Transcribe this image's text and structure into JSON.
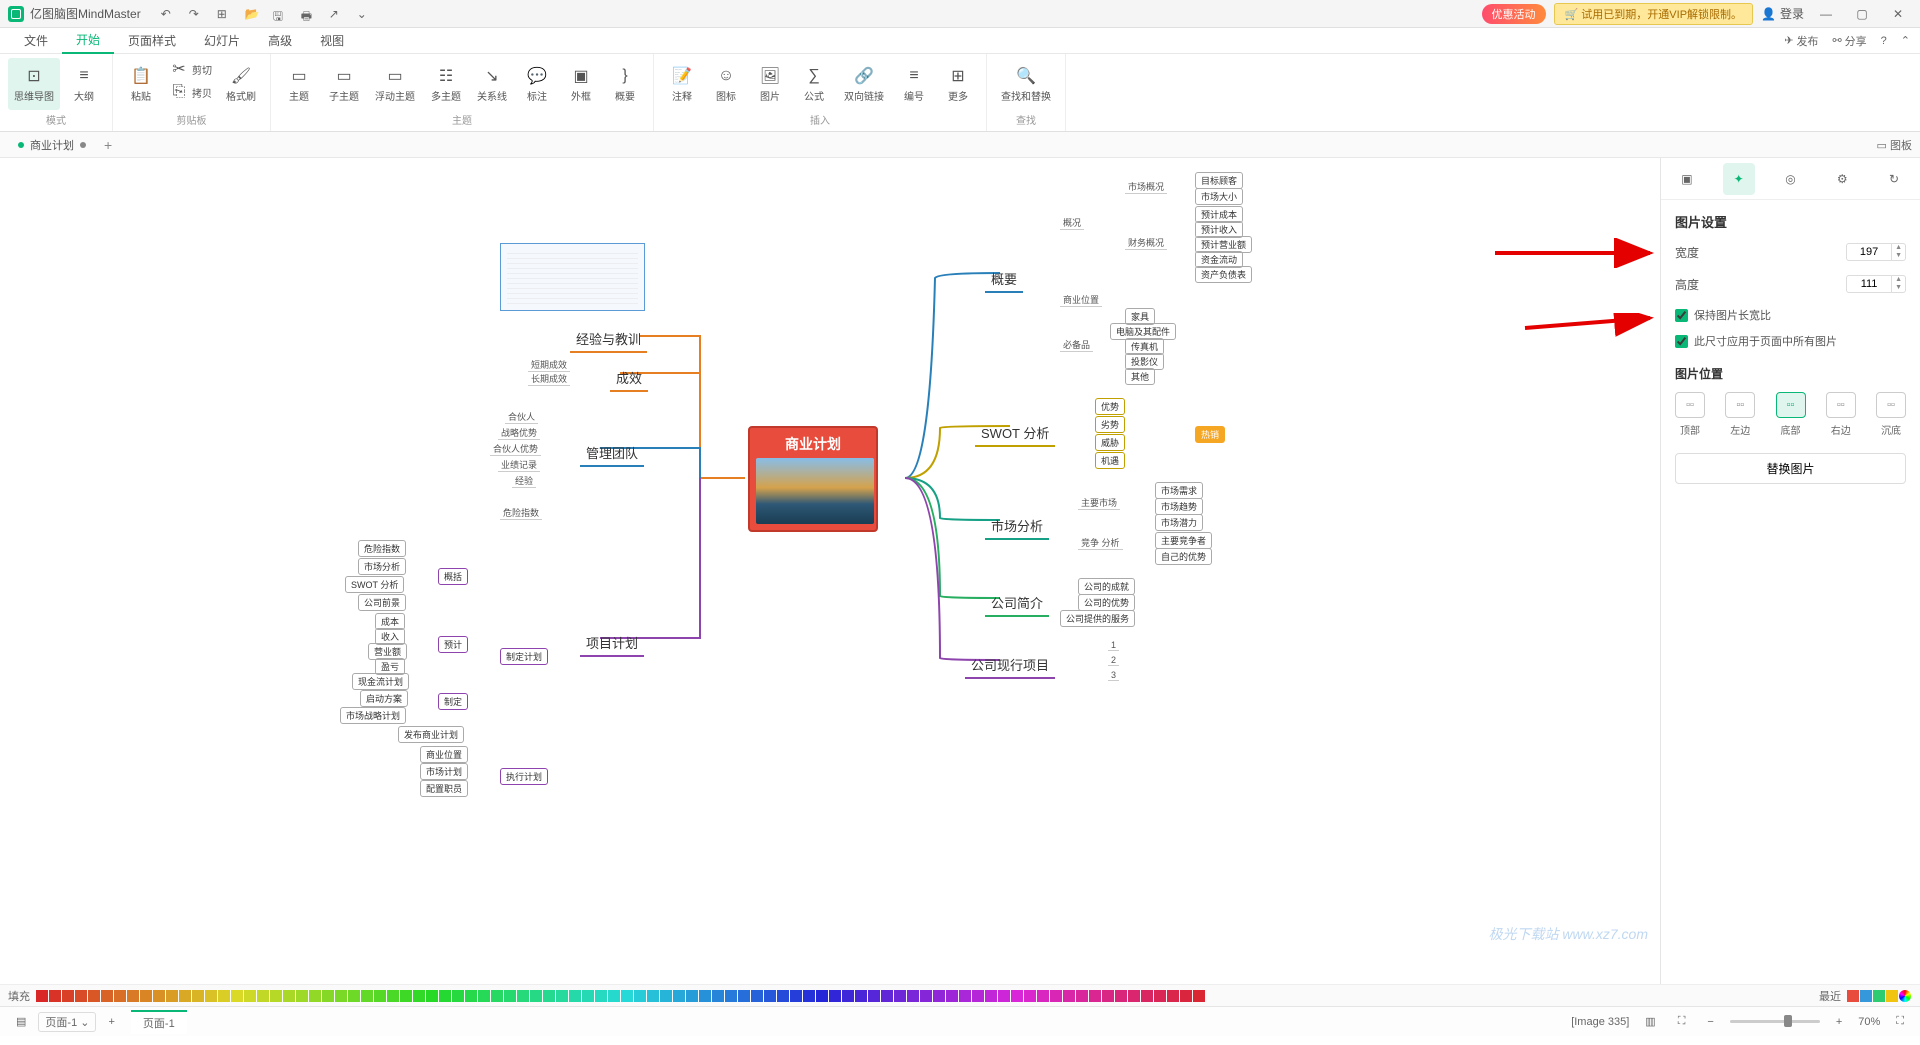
{
  "app": {
    "name": "亿图脑图MindMaster"
  },
  "titlebar": {
    "promo": "优惠活动",
    "trial": "🛒 试用已到期，开通VIP解锁限制。",
    "login": "登录"
  },
  "menu": {
    "items": [
      "文件",
      "开始",
      "页面样式",
      "幻灯片",
      "高级",
      "视图"
    ],
    "active": 1,
    "publish": "发布",
    "share": "分享"
  },
  "ribbon": {
    "mode": {
      "mindmap": "思维导图",
      "outline": "大纲",
      "group": "模式"
    },
    "clipboard": {
      "paste": "粘贴",
      "cut": "剪切",
      "copy": "拷贝",
      "format": "格式刷",
      "group": "剪贴板"
    },
    "topic": {
      "topic": "主题",
      "subtopic": "子主题",
      "floating": "浮动主题",
      "multi": "多主题",
      "relation": "关系线",
      "callout": "标注",
      "boundary": "外框",
      "summary": "概要",
      "group": "主题"
    },
    "insert": {
      "note": "注释",
      "icon": "图标",
      "image": "图片",
      "formula": "公式",
      "link": "双向链接",
      "number": "编号",
      "more": "更多",
      "group": "插入"
    },
    "find": {
      "findreplace": "查找和替换",
      "group": "查找"
    }
  },
  "doctab": {
    "name": "商业计划"
  },
  "panel_toggle": "图板",
  "rightpanel": {
    "title": "图片设置",
    "width_label": "宽度",
    "width_value": "197",
    "height_label": "高度",
    "height_value": "111",
    "keep_ratio": "保持图片长宽比",
    "apply_all": "此尺寸应用于页面中所有图片",
    "position_title": "图片位置",
    "positions": {
      "top": "顶部",
      "left": "左边",
      "bottom": "底部",
      "right": "右边",
      "sink": "沉底"
    },
    "replace": "替换图片"
  },
  "colorbar": {
    "fill": "填充",
    "recent": "最近"
  },
  "statusbar": {
    "page_selector": "页面-1",
    "page_tab": "页面-1",
    "image_label": "[Image 335]",
    "zoom": "70%"
  },
  "watermark": "极光下载站 www.xz7.com",
  "mindmap": {
    "root": "商业计划",
    "left": {
      "experience": "经验与教训",
      "result": {
        "label": "成效",
        "children": [
          "短期成效",
          "长期成效"
        ]
      },
      "team": {
        "label": "管理团队",
        "children": [
          "合伙人",
          "战略优势",
          "合伙人优势",
          "业绩记录",
          "经验"
        ]
      },
      "plan": {
        "label": "项目计划",
        "summary": {
          "label": "概括",
          "children": [
            "危险指数",
            "市场分析",
            "SWOT 分析",
            "公司前景"
          ]
        },
        "forecast": {
          "label": "预计",
          "children": [
            "成本",
            "收入",
            "营业额",
            "盈亏"
          ]
        },
        "make": {
          "label": "制定计划",
          "children": [
            "现金流计划",
            "启动方案",
            "市场战略计划",
            "发布商业计划"
          ]
        },
        "execute": {
          "label": "执行计划",
          "children": [
            "商业位置",
            "市场计划",
            "配置职员"
          ]
        }
      }
    },
    "right": {
      "overview": {
        "label": "概要",
        "situation": {
          "label": "概况",
          "market": {
            "label": "市场概况",
            "children": [
              "目标顾客",
              "市场大小"
            ]
          },
          "finance": {
            "label": "财务概况",
            "children": [
              "预计成本",
              "预计收入",
              "预计营业额",
              "资金流动",
              "资产负债表"
            ]
          }
        },
        "location": "商业位置",
        "equip": {
          "label": "必备品",
          "children": [
            "家具",
            "电脑及其配件",
            "传真机",
            "投影仪",
            "其他"
          ]
        }
      },
      "swot": {
        "label": "SWOT 分析",
        "children": [
          "优势",
          "劣势",
          "威胁",
          "机遇"
        ],
        "badge": "热销"
      },
      "market": {
        "label": "市场分析",
        "main": {
          "label": "主要市场",
          "children": [
            "市场需求",
            "市场趋势",
            "市场潜力"
          ]
        },
        "compete": {
          "label": "竞争 分析",
          "children": [
            "主要竞争者",
            "自己的优势"
          ]
        }
      },
      "company": {
        "label": "公司简介",
        "children": [
          "公司的成就",
          "公司的优势",
          "公司提供的服务"
        ]
      },
      "current": {
        "label": "公司现行项目",
        "children": [
          "1",
          "2",
          "3"
        ]
      }
    }
  }
}
